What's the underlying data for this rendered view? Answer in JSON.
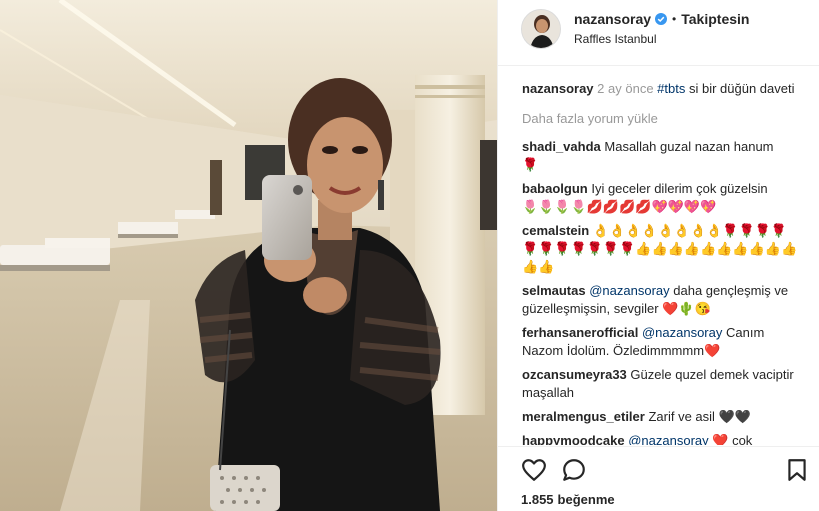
{
  "post": {
    "user": "nazansoray",
    "follow_status": "Takiptesin",
    "location": "Raffles Istanbul",
    "likes_count": "1.855",
    "likes_label": "beğenme"
  },
  "caption": {
    "user": "nazansoray",
    "time": "2 ay önce",
    "hashtag": "#tbts",
    "text": "si bir düğün daveti"
  },
  "load_more": "Daha fazla yorum yükle",
  "comments": [
    {
      "user": "shadi_vahda",
      "text": "Masallah guzal nazan hanum",
      "emoji": "🌹"
    },
    {
      "user": "babaolgun",
      "text": "Iyi geceler dilerim çok güzelsin",
      "emoji": "🌷🌷🌷🌷💋💋💋💋💖💖💖💖"
    },
    {
      "user": "cemalstein",
      "text": "",
      "emoji": "👌👌👌👌👌👌👌👌🌹🌹🌹🌹🌹🌹🌹🌹🌹🌹🌹👍👍👍👍👍👍👍👍👍👍👍👍"
    },
    {
      "user": "selmautas",
      "mention": "@nazansoray",
      "text": "daha gençleşmiş ve güzelleşmişsin, sevgiler",
      "emoji": "❤️🌵😘"
    },
    {
      "user": "ferhansanerofficial",
      "mention": "@nazansoray",
      "text": "Canım Nazom İdolüm. Özledimmmmm",
      "emoji": "❤️"
    },
    {
      "user": "ozcansumeyra33",
      "text": "Güzele quzel demek vaciptir maşallah",
      "emoji": ""
    },
    {
      "user": "meralmengus_etiler",
      "text": "Zarif ve asil",
      "emoji": "🖤🖤"
    },
    {
      "user": "happymoodcake",
      "mention": "@nazansoray",
      "text": "cok",
      "emoji": "❤️"
    }
  ],
  "icons": {
    "like": "heart-icon",
    "comment": "comment-icon",
    "save": "bookmark-icon",
    "verified": "verified-badge-icon"
  },
  "colors": {
    "link": "#003569",
    "muted": "#999999",
    "verified": "#3897f0",
    "border": "#efefef"
  }
}
